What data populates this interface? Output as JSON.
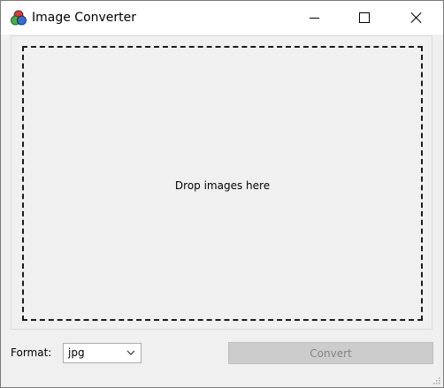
{
  "window": {
    "title": "Image Converter",
    "icon": "three-circles-icon",
    "controls": [
      "minimize-icon",
      "maximize-icon",
      "close-icon"
    ]
  },
  "drop_zone": {
    "text": "Drop images here"
  },
  "footer": {
    "format_label": "Format:",
    "format_selected": "jpg",
    "convert_label": "Convert",
    "convert_enabled": false
  },
  "colors": {
    "icon_red": "#e03a2f",
    "icon_green": "#3bb54a",
    "icon_blue": "#2f6fd6",
    "disabled_button": "#cccccc",
    "disabled_text": "#838383"
  }
}
